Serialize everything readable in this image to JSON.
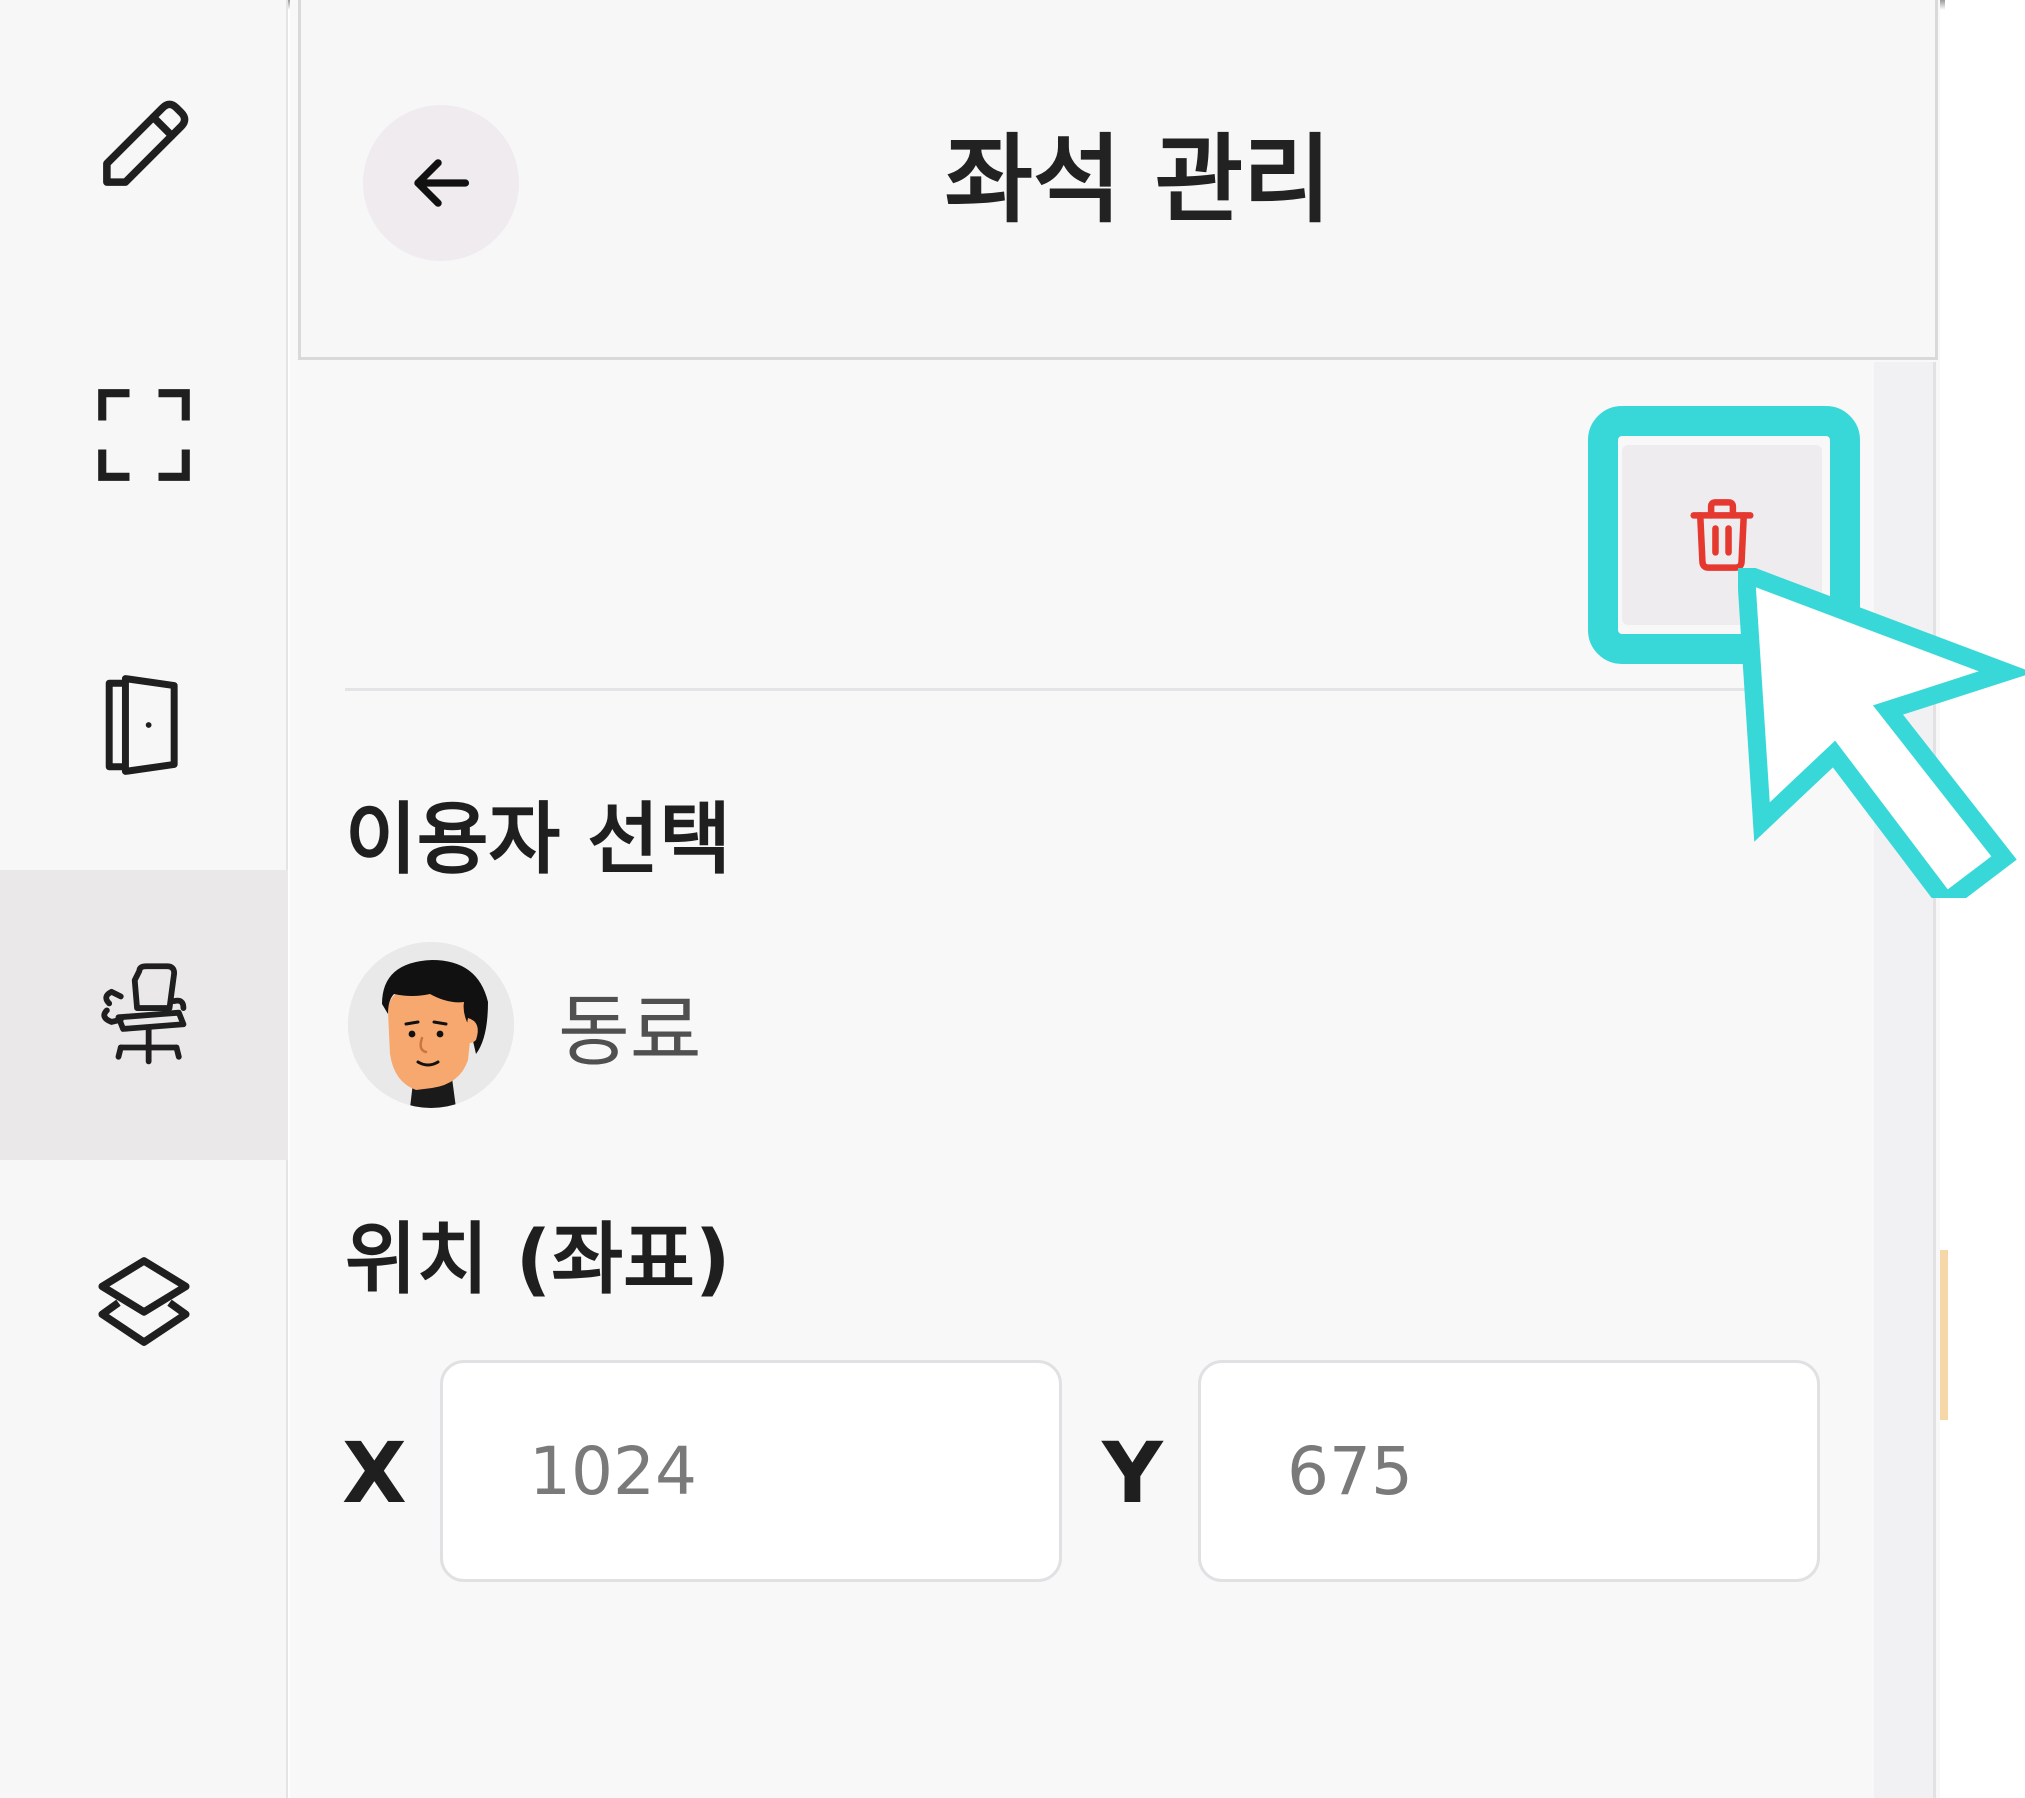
{
  "rail": {
    "items": [
      {
        "name": "pencil-icon"
      },
      {
        "name": "fullscreen-icon"
      },
      {
        "name": "door-icon"
      },
      {
        "name": "office-chair-icon",
        "active": true
      },
      {
        "name": "layers-icon"
      }
    ]
  },
  "panel": {
    "title": "좌석 관리",
    "back_icon": "arrow-left-icon",
    "delete_icon": "trash-icon"
  },
  "user_section": {
    "label": "이용자 선택",
    "selected_user": "동료"
  },
  "position_section": {
    "label": "위치 (좌표)",
    "x_label": "X",
    "y_label": "Y",
    "x_placeholder": "1024",
    "y_placeholder": "675"
  },
  "colors": {
    "highlight": "#38d8d8",
    "delete_red": "#e5392f",
    "active_rail": "#ebe8ea"
  }
}
